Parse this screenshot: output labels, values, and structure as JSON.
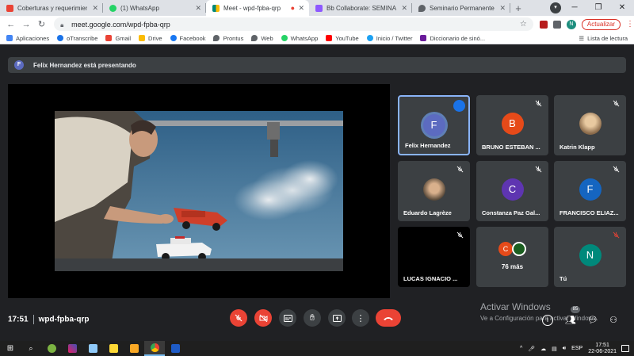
{
  "browser": {
    "tabs": [
      {
        "title": "Coberturas y requerimientos",
        "color": "#ea4335",
        "active": false
      },
      {
        "title": "(1) WhatsApp",
        "color": "#25d366",
        "active": false
      },
      {
        "title": "Meet - wpd-fpba-qrp",
        "color": "#00897b",
        "active": true
      },
      {
        "title": "Bb Collaborate: SEMINARIO",
        "color": "#8e59ff",
        "active": false
      },
      {
        "title": "Seminario Permanente comu",
        "color": "#5f6368",
        "active": false
      }
    ],
    "new_tab_label": "+",
    "url": "meet.google.com/wpd-fpba-qrp",
    "update_label": "Actualizar",
    "profile_initial": "N",
    "bookmarks": [
      {
        "label": "Aplicaciones",
        "color": "#4285f4"
      },
      {
        "label": "oTranscribe",
        "color": "#1a73e8"
      },
      {
        "label": "Gmail",
        "color": "#ea4335"
      },
      {
        "label": "Drive",
        "color": "#fbbc04"
      },
      {
        "label": "Facebook",
        "color": "#1877f2"
      },
      {
        "label": "Prontus",
        "color": "#5f6368"
      },
      {
        "label": "Web",
        "color": "#5f6368"
      },
      {
        "label": "WhatsApp",
        "color": "#25d366"
      },
      {
        "label": "YouTube",
        "color": "#ff0000"
      },
      {
        "label": "Inicio / Twitter",
        "color": "#1da1f2"
      },
      {
        "label": "Diccionario de sinó...",
        "color": "#6a1b9a"
      }
    ],
    "reading_list_label": "Lista de lectura"
  },
  "meet": {
    "banner": {
      "initial": "F",
      "text": "Felix Hernandez está presentando"
    },
    "participants": [
      {
        "name": "Felix Hernandez",
        "initial": "F",
        "color": "#5c6bc0",
        "speaking": true,
        "photo": false
      },
      {
        "name": "BRUNO ESTEBAN ...",
        "initial": "B",
        "color": "#e64a19",
        "speaking": false,
        "photo": false
      },
      {
        "name": "Katrin Klapp",
        "initial": "",
        "color": "#b08060",
        "speaking": false,
        "photo": true
      },
      {
        "name": "Eduardo Lagrèze",
        "initial": "",
        "color": "#8d6e63",
        "speaking": false,
        "photo": true
      },
      {
        "name": "Constanza Paz Gal...",
        "initial": "C",
        "color": "#5e35b1",
        "speaking": false,
        "photo": false
      },
      {
        "name": "FRANCISCO ELIAZ...",
        "initial": "F",
        "color": "#1565c0",
        "speaking": false,
        "photo": false
      },
      {
        "name": "LUCAS IGNACIO ...",
        "initial": "",
        "color": "#000000",
        "speaking": false,
        "photo": false
      },
      {
        "name": "76 más",
        "initial": "C",
        "color": "#e64a19",
        "speaking": false,
        "photo": false
      },
      {
        "name": "Tú",
        "initial": "N",
        "color": "#00897b",
        "speaking": false,
        "photo": false
      }
    ],
    "time": "17:51",
    "meeting_code": "wpd-fpba-qrp",
    "people_count": "85",
    "activate_title": "Activar Windows",
    "activate_sub": "Ve a Configuración para activar Windows."
  },
  "taskbar": {
    "language": "ESP",
    "clock_time": "17:51",
    "clock_date": "22-06-2021"
  }
}
